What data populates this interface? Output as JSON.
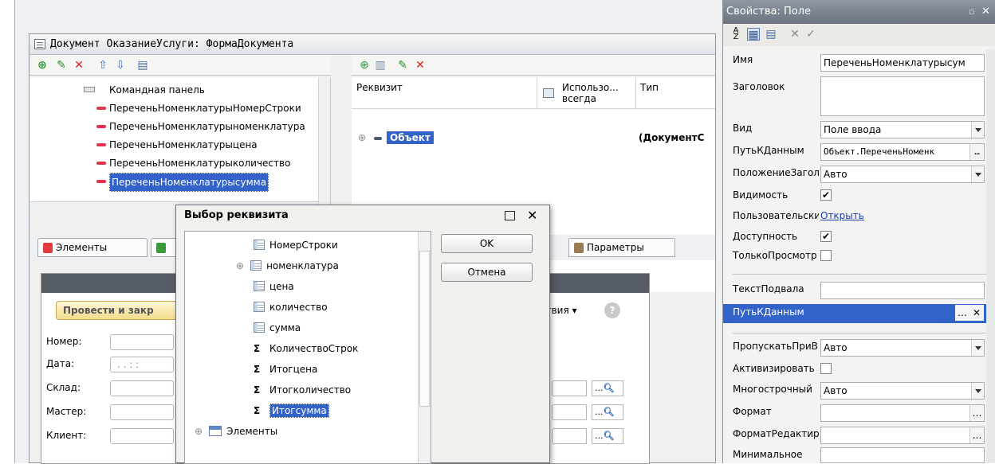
{
  "doc_window": {
    "title": "Документ ОказаниеУслуги: ФормаДокумента"
  },
  "left_tree": {
    "items": [
      {
        "label": "Командная панель",
        "icon": "command-panel-icon"
      },
      {
        "label": "ПереченьНоменклатурыНомерСтроки",
        "icon": "field-icon"
      },
      {
        "label": "ПереченьНоменклатурыноменклатура",
        "icon": "field-icon"
      },
      {
        "label": "ПереченьНоменклатурыцена",
        "icon": "field-icon"
      },
      {
        "label": "ПереченьНоменклатурыколичество",
        "icon": "field-icon"
      },
      {
        "label": "ПереченьНоменклатурысумма",
        "icon": "field-icon",
        "selected": true
      }
    ]
  },
  "right_pane": {
    "columns": [
      "Реквизит",
      "Использо... всегда",
      "Тип"
    ],
    "row": {
      "name": "Объект",
      "type": "(ДокументС"
    }
  },
  "tabs": {
    "elements": "Элементы",
    "parameters": "Параметры"
  },
  "preview": {
    "post_close": "Провести и закр",
    "actions": "ствия ▾",
    "help": "?",
    "fields": [
      "Номер:",
      "Дата:",
      "Склад:",
      "Мастер:",
      "Клиент:"
    ],
    "date_value": ". .   : :"
  },
  "dialog": {
    "title": "Выбор реквизита",
    "ok": "OK",
    "cancel": "Отмена",
    "items": [
      {
        "label": "НомерСтроки",
        "icon": "table-icon",
        "expand": false
      },
      {
        "label": "номенклатура",
        "icon": "table-icon",
        "expand": true
      },
      {
        "label": "цена",
        "icon": "table-icon",
        "expand": false
      },
      {
        "label": "количество",
        "icon": "table-icon",
        "expand": false
      },
      {
        "label": "сумма",
        "icon": "table-icon",
        "expand": false
      },
      {
        "label": "КоличествоСтрок",
        "icon": "sigma-icon",
        "expand": false
      },
      {
        "label": "Итогцена",
        "icon": "sigma-icon",
        "expand": false
      },
      {
        "label": "Итогколичество",
        "icon": "sigma-icon",
        "expand": false
      },
      {
        "label": "Итогсумма",
        "icon": "sigma-icon",
        "expand": false,
        "selected": true
      },
      {
        "label": "Элементы",
        "icon": "list-icon",
        "expand": true
      }
    ]
  },
  "props": {
    "title": "Свойства: Поле",
    "rows": [
      {
        "name": "Имя",
        "value": "ПереченьНоменклатурысум",
        "kind": "text"
      },
      {
        "name": "Заголовок",
        "value": "",
        "kind": "multiline"
      },
      {
        "name": "Вид",
        "value": "Поле ввода",
        "kind": "select"
      },
      {
        "name": "ПутьКДанным",
        "value": "Объект.ПереченьНоменк",
        "kind": "choose"
      },
      {
        "name": "ПоложениеЗаголовка",
        "value": "Авто",
        "kind": "select"
      },
      {
        "name": "Видимость",
        "value": "✔",
        "kind": "check"
      },
      {
        "name": "Пользовательские",
        "value": "Открыть",
        "kind": "link"
      },
      {
        "name": "Доступность",
        "value": "✔",
        "kind": "check"
      },
      {
        "name": "ТолькоПросмотр",
        "value": "",
        "kind": "check"
      },
      {
        "name": "ТекстПодвала",
        "value": "",
        "kind": "text"
      },
      {
        "name": "ПутьКДанным",
        "value": "",
        "kind": "active"
      },
      {
        "name": "ПропускатьПриВводе",
        "value": "Авто",
        "kind": "select"
      },
      {
        "name": "Активизировать",
        "value": "",
        "kind": "check"
      },
      {
        "name": "Многострочный",
        "value": "Авто",
        "kind": "select"
      },
      {
        "name": "Формат",
        "value": "",
        "kind": "choose"
      },
      {
        "name": "ФорматРедактирования",
        "value": "",
        "kind": "choose"
      },
      {
        "name": "Минимальное",
        "value": "",
        "kind": "text"
      }
    ]
  },
  "colors": {
    "selection": "#3163c8",
    "title_gray": "#7a838e",
    "red": "#e8324b"
  }
}
